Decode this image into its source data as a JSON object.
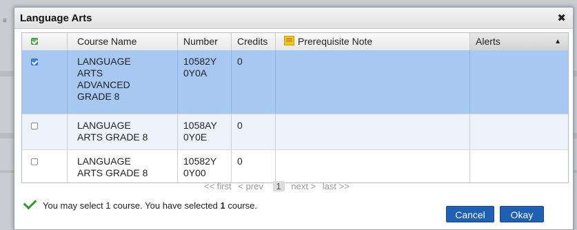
{
  "dialog": {
    "title": "Language Arts",
    "close_symbol": "✖"
  },
  "table": {
    "columns": [
      "Course Name",
      "Number",
      "Credits",
      "Prerequisite Note",
      "Alerts"
    ],
    "rows": [
      {
        "selected": true,
        "course_name": [
          "LANGUAGE",
          "ARTS",
          "ADVANCED",
          "GRADE 8"
        ],
        "number": [
          "10582Y",
          "0Y0A"
        ],
        "credits": "0"
      },
      {
        "selected": false,
        "course_name": [
          "LANGUAGE",
          "ARTS GRADE 8"
        ],
        "number": [
          "1058AY",
          "0Y0E"
        ],
        "credits": "0"
      },
      {
        "selected": false,
        "course_name": [
          "LANGUAGE",
          "ARTS GRADE 8"
        ],
        "number": [
          "10582Y",
          "0Y00"
        ],
        "credits": "0"
      }
    ]
  },
  "pager": {
    "first": "<< first",
    "prev": "< prev",
    "page": "1",
    "next": "next >",
    "last": "last >>"
  },
  "status": {
    "prefix": "You may select 1 course. You have selected ",
    "count": "1",
    "suffix": " course."
  },
  "buttons": {
    "cancel": "Cancel",
    "okay": "Okay"
  },
  "icons": {
    "header_checkbox": "green-check-checkbox-icon",
    "note": "sticky-note-icon",
    "sort": "sort-asc-icon",
    "status": "green-checkmark-icon",
    "close": "close-icon"
  },
  "colors": {
    "selected_row": "#a6c8f2",
    "alt_row": "#edf3fb",
    "button": "#1f5fb4",
    "check": "#2e9a2e"
  }
}
